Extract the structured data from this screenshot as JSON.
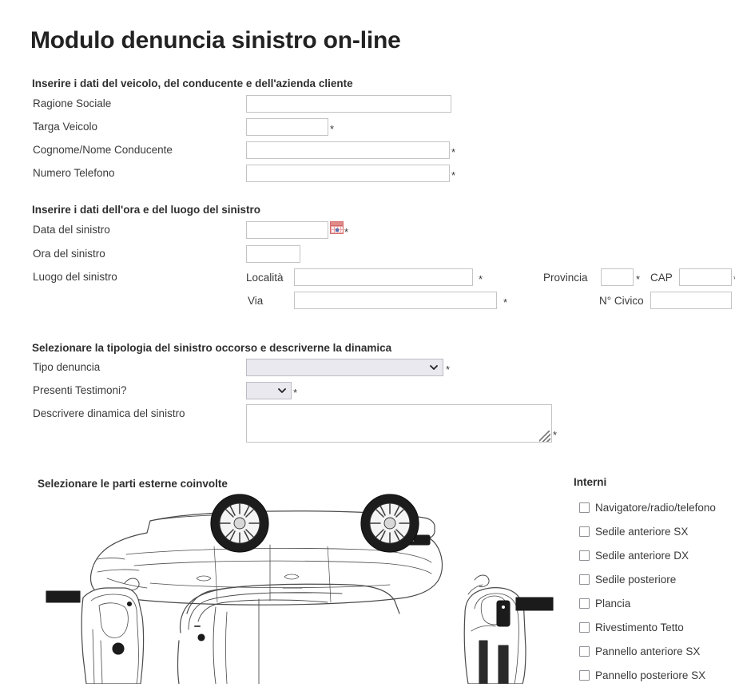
{
  "page": {
    "title": "Modulo denuncia sinistro on-line"
  },
  "sections": {
    "vehicle": {
      "header": "Inserire i dati del veicolo, del conducente e dell'azienda cliente",
      "fields": {
        "ragione_sociale": {
          "label": "Ragione Sociale",
          "value": "",
          "required": false
        },
        "targa": {
          "label": "Targa Veicolo",
          "value": "",
          "required": true,
          "required_mark": "*"
        },
        "conducente": {
          "label": "Cognome/Nome Conducente",
          "value": "",
          "required": true,
          "required_mark": "*"
        },
        "telefono": {
          "label": "Numero Telefono",
          "value": "",
          "required": true,
          "required_mark": "*"
        }
      }
    },
    "when_where": {
      "header": "Inserire i dati dell'ora e del luogo del sinistro",
      "fields": {
        "data": {
          "label": "Data del sinistro",
          "value": "",
          "required": true,
          "required_mark": "*",
          "icon": "calendar-icon"
        },
        "ora": {
          "label": "Ora del sinistro",
          "value": "",
          "required": false
        },
        "luogo": {
          "label": "Luogo del sinistro"
        },
        "localita": {
          "label": "Località",
          "value": "",
          "required": true,
          "required_mark": "*"
        },
        "via": {
          "label": "Via",
          "value": "",
          "required": true,
          "required_mark": "*"
        },
        "provincia": {
          "label": "Provincia",
          "value": "",
          "required": true,
          "required_mark": "*"
        },
        "cap": {
          "label": "CAP",
          "value": "",
          "required": true,
          "required_mark": "*"
        },
        "civico": {
          "label": "N° Civico",
          "value": "",
          "required": false
        }
      }
    },
    "type_dynamics": {
      "header": "Selezionare la tipologia del sinistro occorso e descriverne la dinamica",
      "fields": {
        "tipo_denuncia": {
          "label": "Tipo denuncia",
          "value": "",
          "required": true,
          "required_mark": "*",
          "icon": "chevron-down-icon"
        },
        "testimoni": {
          "label": "Presenti Testimoni?",
          "value": "",
          "required": true,
          "required_mark": "*",
          "icon": "chevron-down-icon"
        },
        "dinamica": {
          "label": "Descrivere dinamica del sinistro",
          "value": "",
          "required": true,
          "required_mark": "*"
        }
      }
    },
    "external_parts": {
      "header": "Selezionare le parti esterne coinvolte"
    },
    "interior": {
      "header": "Interni",
      "items": [
        {
          "label": "Navigatore/radio/telefono",
          "checked": false
        },
        {
          "label": "Sedile anteriore SX",
          "checked": false
        },
        {
          "label": "Sedile anteriore DX",
          "checked": false
        },
        {
          "label": "Sedile posteriore",
          "checked": false
        },
        {
          "label": "Plancia",
          "checked": false
        },
        {
          "label": "Rivestimento Tetto",
          "checked": false
        },
        {
          "label": "Pannello anteriore SX",
          "checked": false
        },
        {
          "label": "Pannello posteriore SX",
          "checked": false
        }
      ]
    }
  },
  "colors": {
    "text": "#3a3a3a",
    "heading": "#222222",
    "input_border": "#c4c4c4",
    "select_bg": "#e9e9ef",
    "calendar_icon": "#d86c6c"
  }
}
